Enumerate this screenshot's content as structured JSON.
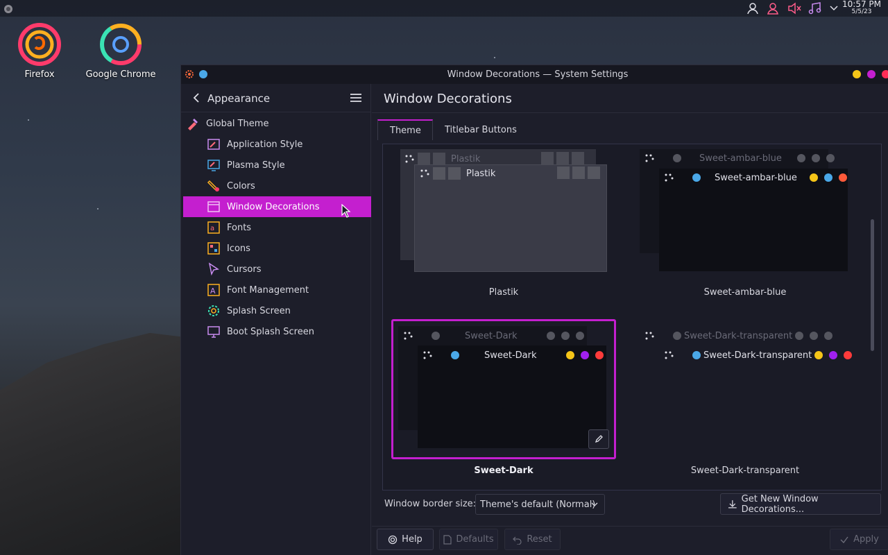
{
  "topbar": {
    "time": "10:57 PM",
    "date": "5/5/23",
    "tray_icons": [
      "user-icon",
      "user-pink-icon",
      "volume-muted-icon",
      "music-icon",
      "chevron-down-icon"
    ]
  },
  "desktop": {
    "icons": [
      {
        "label": "Firefox",
        "icon": "firefox-icon"
      },
      {
        "label": "Google Chrome",
        "icon": "chrome-icon"
      }
    ]
  },
  "window": {
    "title": "Window Decorations — System Settings",
    "button_colors": [
      "#f5c518",
      "#c41fcf",
      "#ff2d55"
    ]
  },
  "sidebar": {
    "header": "Appearance",
    "items": [
      {
        "label": "Global Theme",
        "icon": "global-theme-icon"
      },
      {
        "label": "Application Style",
        "icon": "application-style-icon"
      },
      {
        "label": "Plasma Style",
        "icon": "plasma-style-icon"
      },
      {
        "label": "Colors",
        "icon": "colors-icon"
      },
      {
        "label": "Window Decorations",
        "icon": "window-decorations-icon",
        "selected": true
      },
      {
        "label": "Fonts",
        "icon": "fonts-icon"
      },
      {
        "label": "Icons",
        "icon": "icons-icon"
      },
      {
        "label": "Cursors",
        "icon": "cursors-icon"
      },
      {
        "label": "Font Management",
        "icon": "font-management-icon"
      },
      {
        "label": "Splash Screen",
        "icon": "splash-screen-icon"
      },
      {
        "label": "Boot Splash Screen",
        "icon": "boot-splash-screen-icon"
      }
    ]
  },
  "main": {
    "title": "Window Decorations",
    "tabs": [
      {
        "label": "Theme",
        "active": true
      },
      {
        "label": "Titlebar Buttons",
        "active": false
      }
    ],
    "themes": [
      {
        "name": "Plastik",
        "preview_title": "Plastik",
        "selected": false
      },
      {
        "name": "Sweet-ambar-blue",
        "preview_title": "Sweet-ambar-blue",
        "selected": false
      },
      {
        "name": "Sweet-Dark",
        "preview_title": "Sweet-Dark",
        "selected": true
      },
      {
        "name": "Sweet-Dark-transparent",
        "preview_title": "Sweet-Dark-transparent",
        "selected": false
      }
    ],
    "border_size_label": "Window border size:",
    "border_size_value": "Theme's default (Normal)",
    "get_new_label": "Get New Window Decorations...",
    "accent": "#c41fcf"
  },
  "footer": {
    "help": "Help",
    "defaults": "Defaults",
    "reset": "Reset",
    "apply": "Apply"
  }
}
